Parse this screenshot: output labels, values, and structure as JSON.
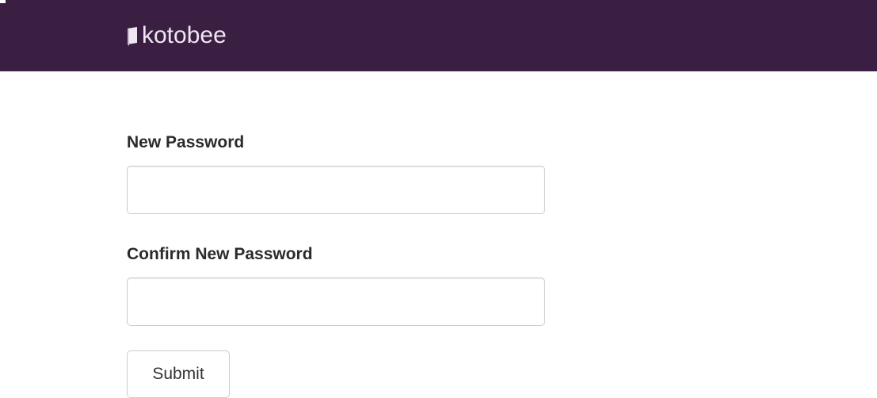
{
  "header": {
    "logo_text": "kotobee",
    "logo_icon": "book-icon",
    "background_color": "#3a1f43"
  },
  "form": {
    "new_password_label": "New Password",
    "new_password_value": "",
    "confirm_password_label": "Confirm New Password",
    "confirm_password_value": "",
    "submit_label": "Submit"
  }
}
